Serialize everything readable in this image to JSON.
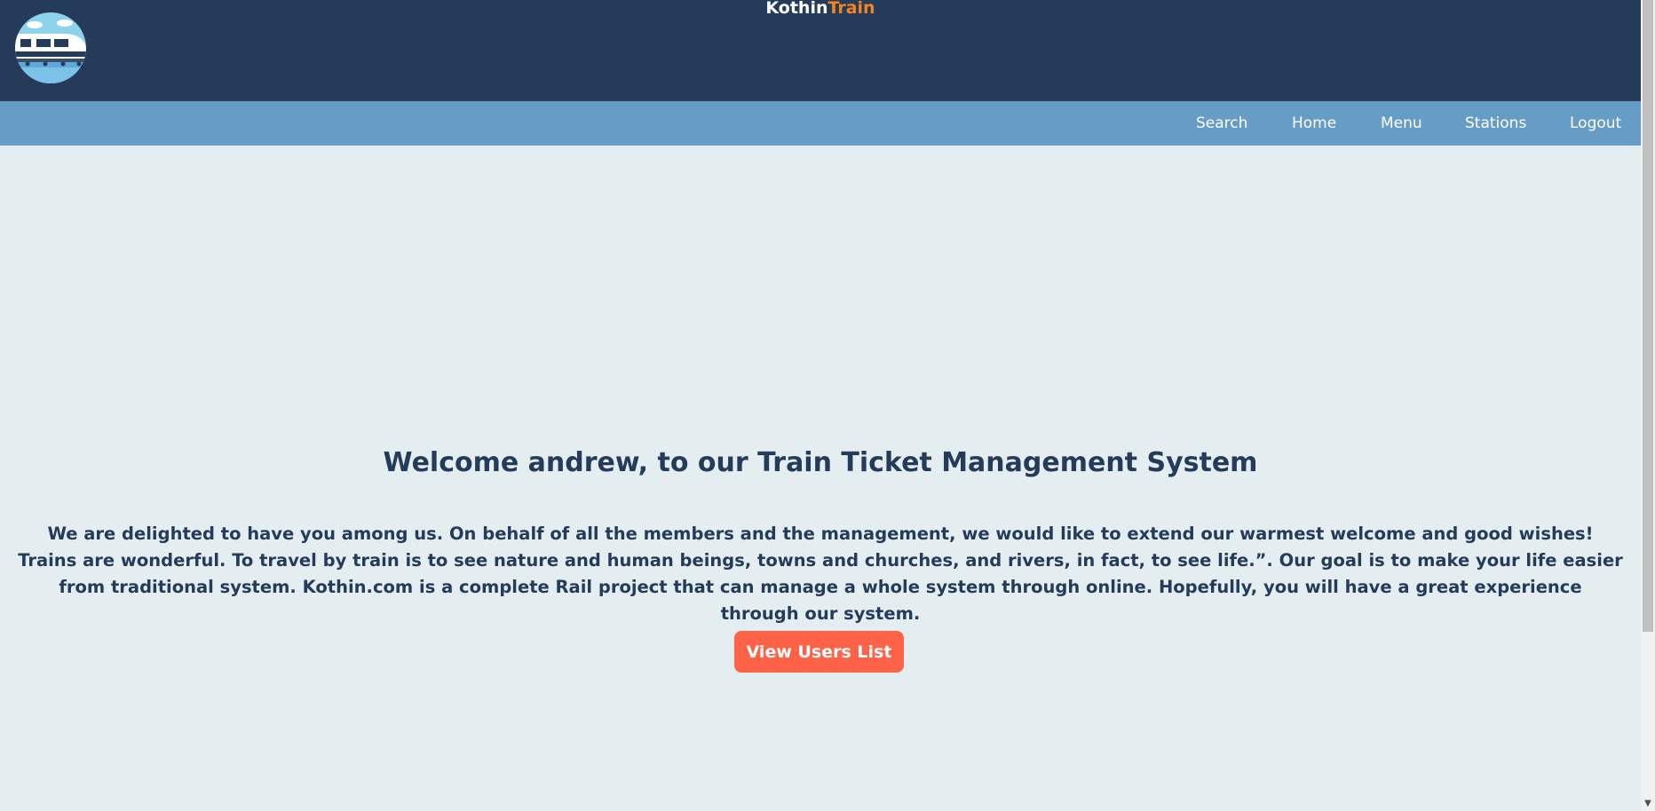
{
  "header": {
    "brand_first": "Kothin",
    "brand_second": "Train",
    "logo_icon": "train-icon",
    "colors": {
      "header_bg": "#253b5a",
      "nav_bg": "#679cc6",
      "brand_accent": "#f5841f",
      "page_bg": "#e4eef0",
      "button_bg": "#ff6347"
    }
  },
  "nav": {
    "items": [
      {
        "label": "Search"
      },
      {
        "label": "Home"
      },
      {
        "label": "Menu"
      },
      {
        "label": "Stations"
      },
      {
        "label": "Logout"
      }
    ]
  },
  "main": {
    "title": "Welcome andrew, to our Train Ticket Management System",
    "paragraph": "We are delighted to have you among us. On behalf of all the members and the management, we would like to extend our warmest welcome and good wishes! Trains are wonderful. To travel by train is to see nature and human beings, towns and churches, and rivers, in fact, to see life.”. Our goal is to make your life easier from traditional system. Kothin.com is a complete Rail project that can manage a whole system through online. Hopefully, you will have a great experience through our system.",
    "button_label": "View Users List"
  }
}
